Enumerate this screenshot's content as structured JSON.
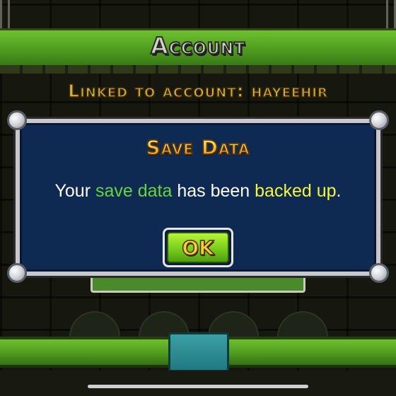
{
  "header": {
    "title": "Account"
  },
  "account": {
    "linked_text": "Linked to account: hayeehir"
  },
  "dialog": {
    "title": "Save Data",
    "message_parts": {
      "p1": "Your ",
      "p2": "save data",
      "p3": " has been ",
      "p4": "backed up",
      "p5": "."
    },
    "ok_label": "OK"
  },
  "colors": {
    "header_green": "#55a323",
    "dialog_bg": "#0e2a52",
    "title_gold": "#f7c02e",
    "highlight_green": "#63d63a",
    "highlight_yellow": "#f5f53a",
    "button_green": "#7ed21c"
  },
  "icons": [
    "chain-icon",
    "rivet-icon"
  ]
}
